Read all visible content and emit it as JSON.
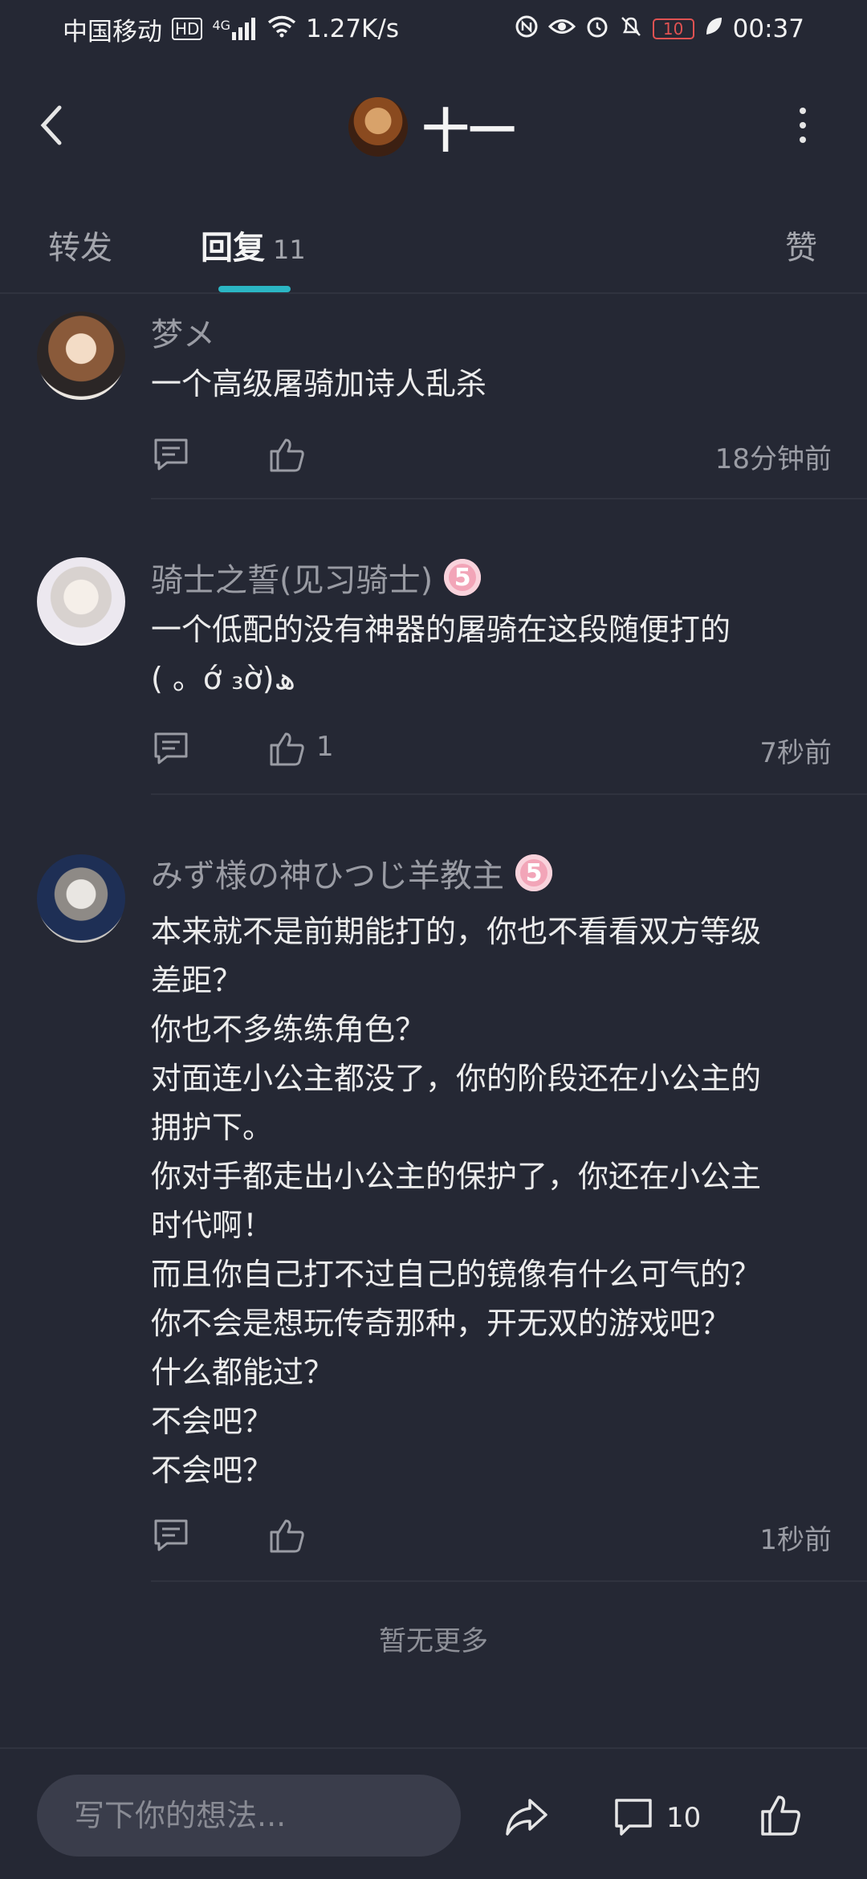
{
  "status_bar": {
    "carrier": "中国移动",
    "hd": "HD",
    "network": "4G",
    "speed": "1.27K/s",
    "battery": "10",
    "time": "00:37"
  },
  "header": {
    "title": "十一"
  },
  "tabs": {
    "forward_label": "转发",
    "reply_label": "回复",
    "reply_count": "11",
    "like_label": "赞"
  },
  "comments": [
    {
      "username": "梦メ",
      "level": "",
      "content": "一个高级屠骑加诗人乱杀",
      "likes": "",
      "time": "18分钟前"
    },
    {
      "username": "骑士之誓(见习骑士)",
      "level": "5",
      "content": "一个低配的没有神器的屠骑在这段随便打的\n( 。ớ ₃ờ)ھ",
      "likes": "1",
      "time": "7秒前"
    },
    {
      "username": "みず様の神ひつじ羊教主",
      "level": "5",
      "content": "本来就不是前期能打的，你也不看看双方等级\n差距？\n你也不多练练角色？\n对面连小公主都没了，你的阶段还在小公主的\n拥护下。\n你对手都走出小公主的保护了，你还在小公主\n时代啊！\n而且你自己打不过自己的镜像有什么可气的？\n你不会是想玩传奇那种，开无双的游戏吧？\n什么都能过？\n不会吧？\n不会吧？",
      "likes": "",
      "time": "1秒前"
    }
  ],
  "footer": {
    "no_more": "暂无更多"
  },
  "bottom_bar": {
    "input_placeholder": "写下你的想法...",
    "comment_count": "10"
  },
  "colors": {
    "background": "#252834",
    "accent": "#2bb6c4",
    "badge": "#f2a5b8",
    "muted_text": "#9a9ca4"
  }
}
